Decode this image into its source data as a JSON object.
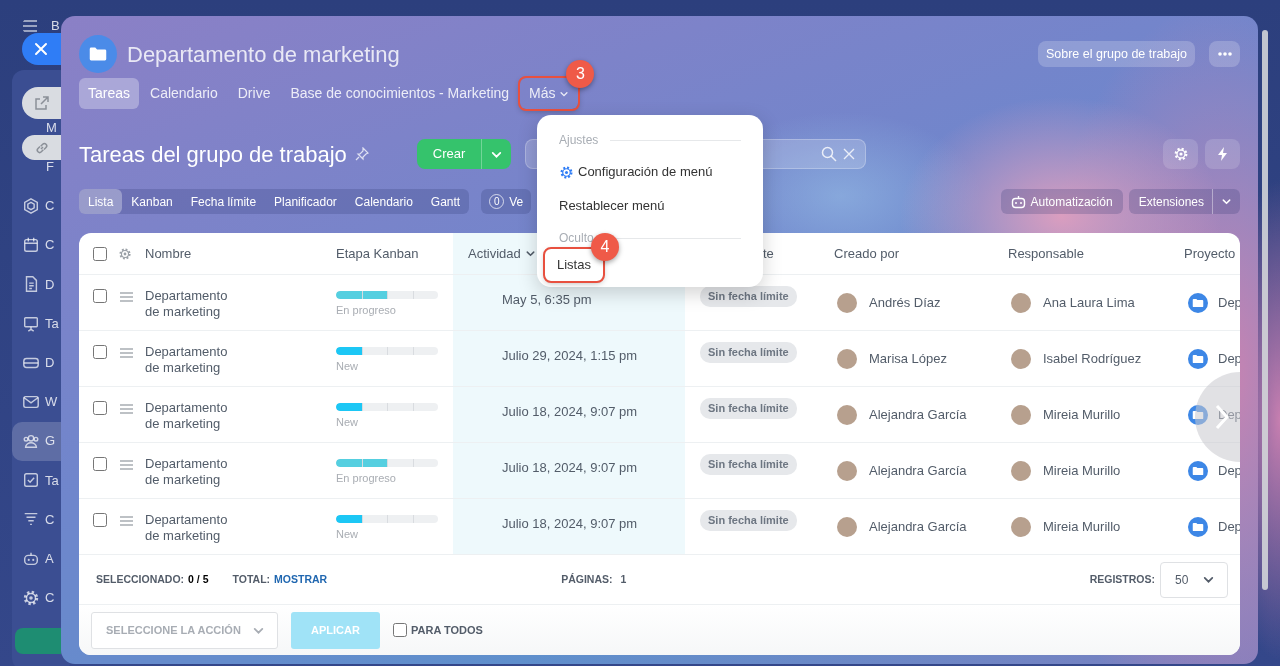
{
  "sidebar": {
    "items": [
      {
        "kind": "menu",
        "label": "B",
        "selected": false
      },
      {
        "kind": "covered",
        "label": "M",
        "selected": false
      },
      {
        "kind": "covered",
        "label": "F",
        "selected": false
      },
      {
        "kind": "hexagon",
        "label": "C",
        "selected": false
      },
      {
        "kind": "calendar",
        "label": "C",
        "selected": false
      },
      {
        "kind": "document",
        "label": "D",
        "selected": false
      },
      {
        "kind": "board",
        "label": "Ta",
        "selected": false
      },
      {
        "kind": "drive",
        "label": "D",
        "selected": false
      },
      {
        "kind": "mail",
        "label": "W",
        "selected": false
      },
      {
        "kind": "group",
        "label": "G",
        "selected": true
      },
      {
        "kind": "checkbox",
        "label": "Ta",
        "selected": false
      },
      {
        "kind": "filter",
        "label": "C",
        "selected": false
      },
      {
        "kind": "robot",
        "label": "A",
        "selected": false
      },
      {
        "kind": "gear",
        "label": "C",
        "selected": false
      }
    ]
  },
  "group": {
    "title": "Departamento de marketing",
    "about_button": "Sobre el grupo de trabajo"
  },
  "tabs": [
    {
      "label": "Tareas",
      "selected": true
    },
    {
      "label": "Calendario",
      "selected": false
    },
    {
      "label": "Drive",
      "selected": false
    },
    {
      "label": "Base de conocimientos - Marketing",
      "selected": false
    },
    {
      "label": "Más",
      "selected": false,
      "kind": "dropdown",
      "callout": "3"
    }
  ],
  "menu": {
    "sections": [
      {
        "title": "Ajustes",
        "items": [
          {
            "kind": "gear",
            "label": "Configuración de menú"
          },
          {
            "kind": "plain",
            "label": "Restablecer menú"
          }
        ]
      },
      {
        "title": "Oculto",
        "items": [
          {
            "kind": "plain",
            "label": "Listas",
            "callout": "4"
          }
        ]
      }
    ]
  },
  "page": {
    "title": "Tareas del grupo de trabajo",
    "create_button": "Crear"
  },
  "views": [
    {
      "label": "Lista",
      "selected": true
    },
    {
      "label": "Kanban",
      "selected": false
    },
    {
      "label": "Fecha límite",
      "selected": false
    },
    {
      "label": "Planificador",
      "selected": false
    },
    {
      "label": "Calendario",
      "selected": false
    },
    {
      "label": "Gantt",
      "selected": false
    }
  ],
  "counter_chip": {
    "count": "0",
    "label": "Ve"
  },
  "automation_button": "Automatización",
  "extensions_button": "Extensiones",
  "table": {
    "select_all_checked": false,
    "columns": [
      {
        "label": "Nombre",
        "sorted": false
      },
      {
        "label": "Etapa Kanban",
        "sorted": false
      },
      {
        "label": "Actividad",
        "sorted": true
      },
      {
        "label": "te",
        "sorted": false
      },
      {
        "label": "Creado por",
        "sorted": false
      },
      {
        "label": "Responsable",
        "sorted": false
      },
      {
        "label": "Proyecto",
        "sorted": false
      }
    ],
    "rows": [
      {
        "checked": false,
        "name": "Departamento de marketing",
        "stage": {
          "label": "En progreso",
          "level": 0.5,
          "color": "#55cfe0"
        },
        "activity": "May 5, 6:35 pm",
        "deadline": "Sin fecha límite",
        "created_by": "Andrés Díaz",
        "responsible": "Ana Laura Lima",
        "project": "Dep"
      },
      {
        "checked": false,
        "name": "Departamento de marketing",
        "stage": {
          "label": "New",
          "level": 0.25,
          "color": "#1cc7f5"
        },
        "activity": "Julio 29, 2024, 1:15 pm",
        "deadline": "Sin fecha límite",
        "created_by": "Marisa López",
        "responsible": "Isabel Rodríguez",
        "project": "Dep"
      },
      {
        "checked": false,
        "name": "Departamento de marketing",
        "stage": {
          "label": "New",
          "level": 0.25,
          "color": "#1cc7f5"
        },
        "activity": "Julio 18, 2024, 9:07 pm",
        "deadline": "Sin fecha límite",
        "created_by": "Alejandra García",
        "responsible": "Mireia Murillo",
        "project": "Dep"
      },
      {
        "checked": false,
        "name": "Departamento de marketing",
        "stage": {
          "label": "En progreso",
          "level": 0.5,
          "color": "#55cfe0"
        },
        "activity": "Julio 18, 2024, 9:07 pm",
        "deadline": "Sin fecha límite",
        "created_by": "Alejandra García",
        "responsible": "Mireia Murillo",
        "project": "Dep"
      },
      {
        "checked": false,
        "name": "Departamento de marketing",
        "stage": {
          "label": "New",
          "level": 0.25,
          "color": "#1cc7f5"
        },
        "activity": "Julio 18, 2024, 9:07 pm",
        "deadline": "Sin fecha límite",
        "created_by": "Alejandra García",
        "responsible": "Mireia Murillo",
        "project": "Dep"
      }
    ]
  },
  "footer": {
    "selected_label": "SELECCIONADO:",
    "selected_value": "0 / 5",
    "total_label": "TOTAL:",
    "total_link": "MOSTRAR",
    "pages_label": "PÁGINAS:",
    "pages_value": "1",
    "records_label": "REGISTROS:",
    "records_value": "50"
  },
  "action_bar": {
    "action_placeholder": "SELECCIONE LA ACCIÓN",
    "apply_button": "APLICAR",
    "apply_disabled": true,
    "for_all_label": "PARA TODOS",
    "for_all_checked": false
  }
}
